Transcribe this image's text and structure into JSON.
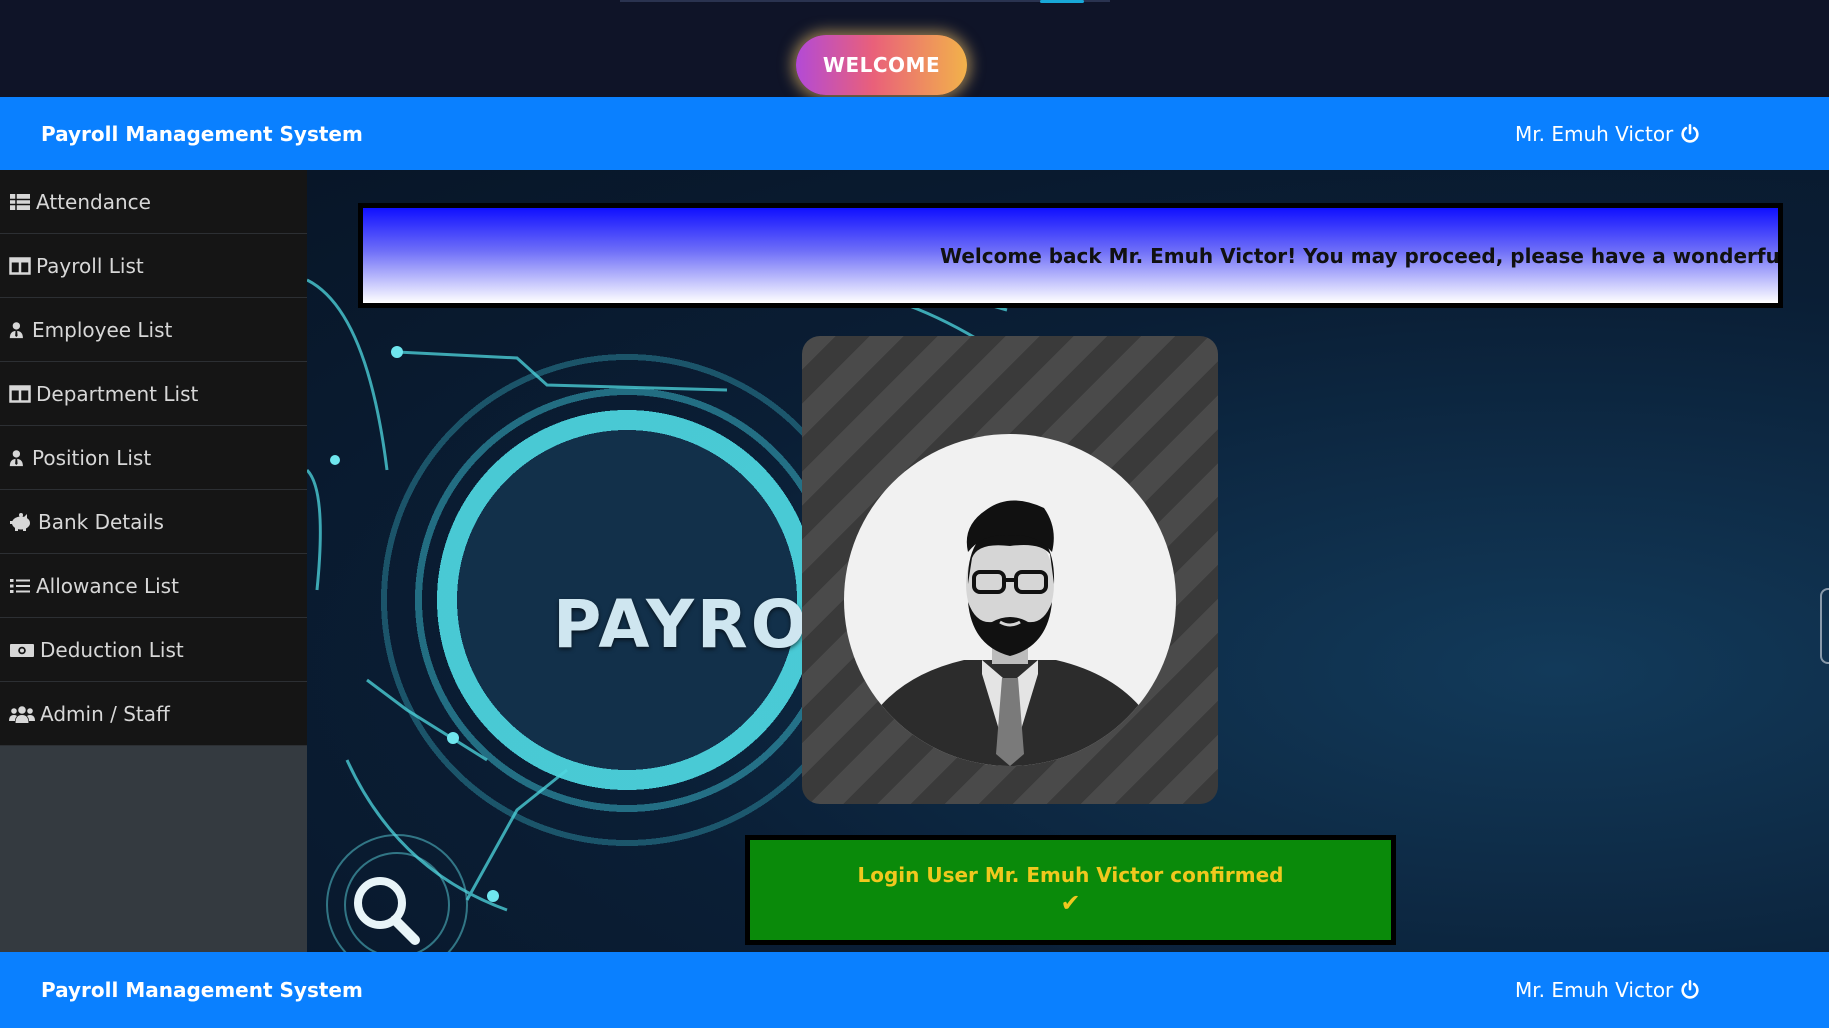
{
  "welcome": {
    "label": "WELCOME"
  },
  "header": {
    "brand": "Payroll Management System",
    "user": "Mr. Emuh Victor"
  },
  "footer": {
    "brand": "Payroll Management System",
    "user": "Mr. Emuh Victor"
  },
  "sidebar": {
    "items": [
      {
        "label": "Attendance",
        "icon": "table-icon"
      },
      {
        "label": "Payroll List",
        "icon": "columns-icon"
      },
      {
        "label": "Employee List",
        "icon": "user-tie-icon"
      },
      {
        "label": "Department List",
        "icon": "columns-icon"
      },
      {
        "label": "Position List",
        "icon": "user-tie-icon"
      },
      {
        "label": "Bank Details",
        "icon": "piggy-bank-icon"
      },
      {
        "label": "Allowance List",
        "icon": "list-icon"
      },
      {
        "label": "Deduction List",
        "icon": "money-bill-icon"
      },
      {
        "label": "Admin / Staff",
        "icon": "users-icon"
      }
    ]
  },
  "main": {
    "marquee": "Welcome back Mr. Emuh Victor! You may proceed, please have a wonderful day",
    "background_word": "PAYROL",
    "confirm": {
      "message": "Login User Mr. Emuh Victor confirmed",
      "icon": "check-icon"
    }
  },
  "colors": {
    "navbar": "#0a80ff",
    "sidebar": "#151515",
    "confirm_bg": "#0a8a0a",
    "confirm_text": "#f0c81e"
  }
}
